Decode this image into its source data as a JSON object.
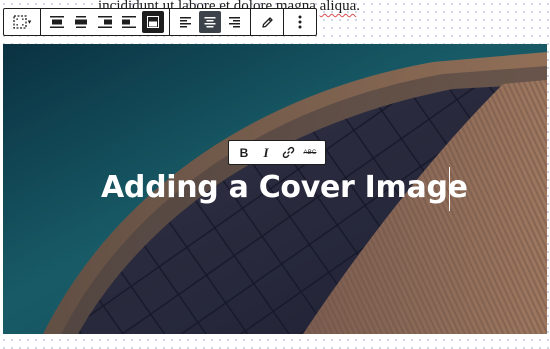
{
  "editor": {
    "paragraph_text_before": "incididunt ut labore et dolore ",
    "paragraph_misspelled_1": "magna",
    "paragraph_space": " ",
    "paragraph_misspelled_2": "aliqua",
    "paragraph_text_after": "."
  },
  "block_toolbar": {
    "buttons": [
      {
        "name": "cover-block-icon",
        "active": false
      },
      {
        "name": "align-wide-icon",
        "active": false
      },
      {
        "name": "align-full-icon",
        "active": false
      },
      {
        "name": "align-right-icon",
        "active": false
      },
      {
        "name": "position-full-icon",
        "active": true
      },
      {
        "name": "text-align-left-icon",
        "active": false
      },
      {
        "name": "text-align-center-icon",
        "active": true
      },
      {
        "name": "text-align-right-icon",
        "active": false
      },
      {
        "name": "pencil-icon",
        "active": false
      },
      {
        "name": "more-options-icon",
        "active": false
      }
    ]
  },
  "format_toolbar": {
    "bold_label": "B",
    "italic_label": "I",
    "link_icon": "link-icon",
    "strikethrough_label": "ABC"
  },
  "cover": {
    "heading": "Adding a Cover Image",
    "overlay_color": "#0d3b47",
    "accent_color": "#c0784f"
  }
}
